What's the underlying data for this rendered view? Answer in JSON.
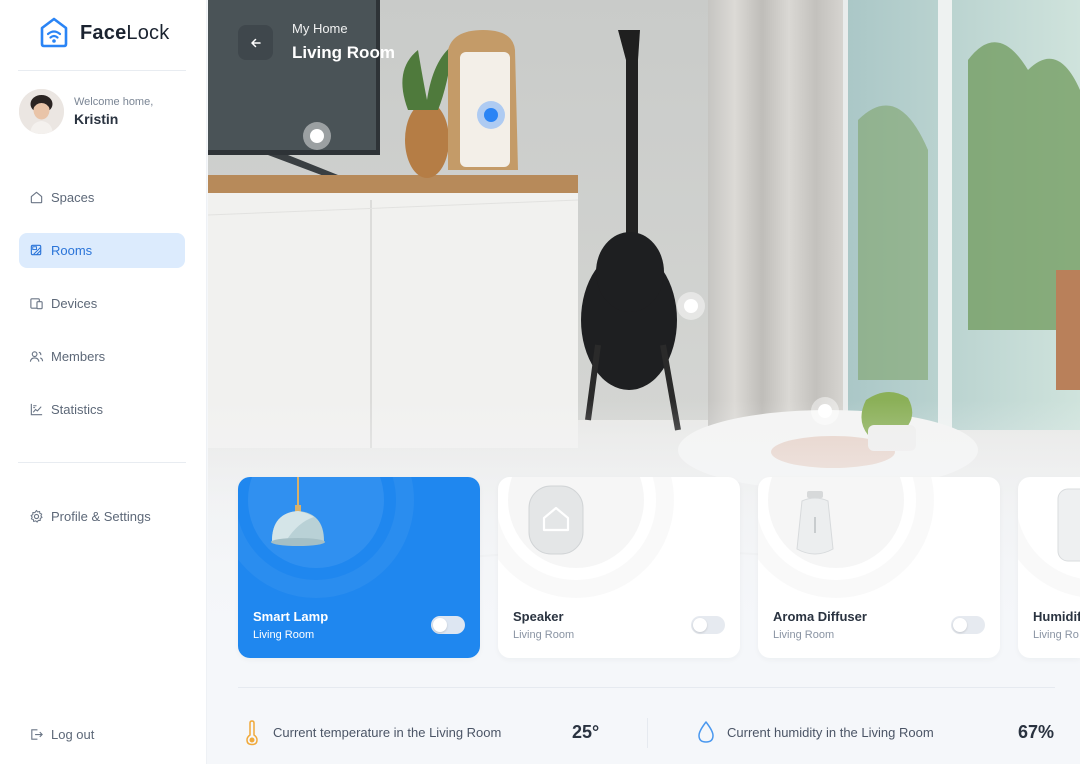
{
  "brand": {
    "name_bold": "Face",
    "name_rest": "Lock"
  },
  "user": {
    "welcome": "Welcome home,",
    "name": "Kristin"
  },
  "nav": {
    "items": [
      {
        "label": "Spaces",
        "icon": "home-icon"
      },
      {
        "label": "Rooms",
        "icon": "rooms-icon",
        "active": true
      },
      {
        "label": "Devices",
        "icon": "devices-icon"
      },
      {
        "label": "Members",
        "icon": "members-icon"
      },
      {
        "label": "Statistics",
        "icon": "statistics-icon"
      }
    ],
    "settings": {
      "label": "Profile & Settings",
      "icon": "gear-icon"
    },
    "logout": {
      "label": "Log out",
      "icon": "logout-icon"
    }
  },
  "header": {
    "breadcrumb": "My Home",
    "title": "Living Room"
  },
  "devices": [
    {
      "name": "Smart Lamp",
      "room": "Living Room",
      "on": true
    },
    {
      "name": "Speaker",
      "room": "Living Room",
      "on": false
    },
    {
      "name": "Aroma Diffuser",
      "room": "Living Room",
      "on": false
    },
    {
      "name": "Humidifier",
      "room": "Living Ro",
      "on": false
    }
  ],
  "stats": {
    "temperature": {
      "label": "Current temperature in the Living Room",
      "value": "25°",
      "icon": "thermometer-icon"
    },
    "humidity": {
      "label": "Current humidity in the Living Room",
      "value": "67%",
      "icon": "droplet-icon"
    }
  },
  "colors": {
    "accent": "#1f87ef",
    "active_nav_bg": "#dcebfd",
    "active_nav_text": "#2a74d8"
  }
}
